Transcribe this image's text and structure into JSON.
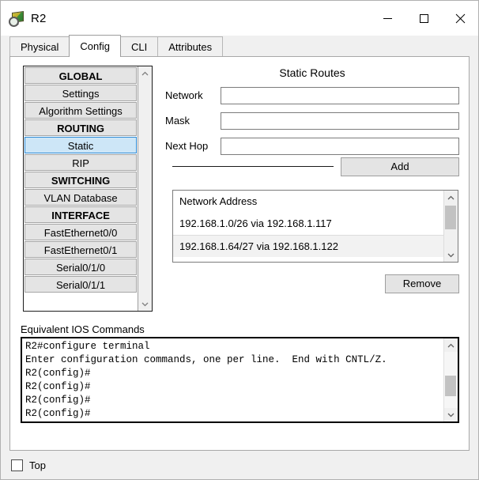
{
  "window": {
    "title": "R2",
    "icon": "router-magnifier-icon",
    "controls": {
      "minimize": "minimize-icon",
      "maximize": "maximize-icon",
      "close": "close-icon"
    }
  },
  "tabs": [
    {
      "label": "Physical",
      "active": false
    },
    {
      "label": "Config",
      "active": true
    },
    {
      "label": "CLI",
      "active": false
    },
    {
      "label": "Attributes",
      "active": false
    }
  ],
  "sidebar": {
    "items": [
      {
        "label": "GLOBAL",
        "type": "header"
      },
      {
        "label": "Settings",
        "type": "item"
      },
      {
        "label": "Algorithm Settings",
        "type": "item"
      },
      {
        "label": "ROUTING",
        "type": "header"
      },
      {
        "label": "Static",
        "type": "item",
        "selected": true
      },
      {
        "label": "RIP",
        "type": "item"
      },
      {
        "label": "SWITCHING",
        "type": "header"
      },
      {
        "label": "VLAN Database",
        "type": "item"
      },
      {
        "label": "INTERFACE",
        "type": "header"
      },
      {
        "label": "FastEthernet0/0",
        "type": "item"
      },
      {
        "label": "FastEthernet0/1",
        "type": "item"
      },
      {
        "label": "Serial0/1/0",
        "type": "item"
      },
      {
        "label": "Serial0/1/1",
        "type": "item"
      }
    ],
    "scroll_up_icon": "chevron-up-icon",
    "scroll_down_icon": "chevron-down-icon"
  },
  "static_routes": {
    "title": "Static Routes",
    "fields": {
      "network": {
        "label": "Network",
        "value": "",
        "placeholder": ""
      },
      "mask": {
        "label": "Mask",
        "value": "",
        "placeholder": ""
      },
      "next_hop": {
        "label": "Next Hop",
        "value": "",
        "placeholder": ""
      }
    },
    "add_label": "Add",
    "remove_label": "Remove",
    "list_header": "Network Address",
    "routes": [
      "192.168.1.0/26 via 192.168.1.117",
      "192.168.1.64/27 via 192.168.1.122"
    ],
    "scroll_up_icon": "chevron-up-icon",
    "scroll_down_icon": "chevron-down-icon"
  },
  "ios": {
    "label": "Equivalent IOS Commands",
    "text": "R2#configure terminal\nEnter configuration commands, one per line.  End with CNTL/Z.\nR2(config)#\nR2(config)#\nR2(config)#\nR2(config)#",
    "scroll_up_icon": "chevron-up-icon",
    "scroll_down_icon": "chevron-down-icon"
  },
  "footer": {
    "top_label": "Top",
    "top_checked": false
  },
  "colors": {
    "selection": "#cde6f7",
    "selection_border": "#2e8ad4",
    "button_face": "#e4e4e4",
    "window_bg": "#f0f0f0"
  }
}
